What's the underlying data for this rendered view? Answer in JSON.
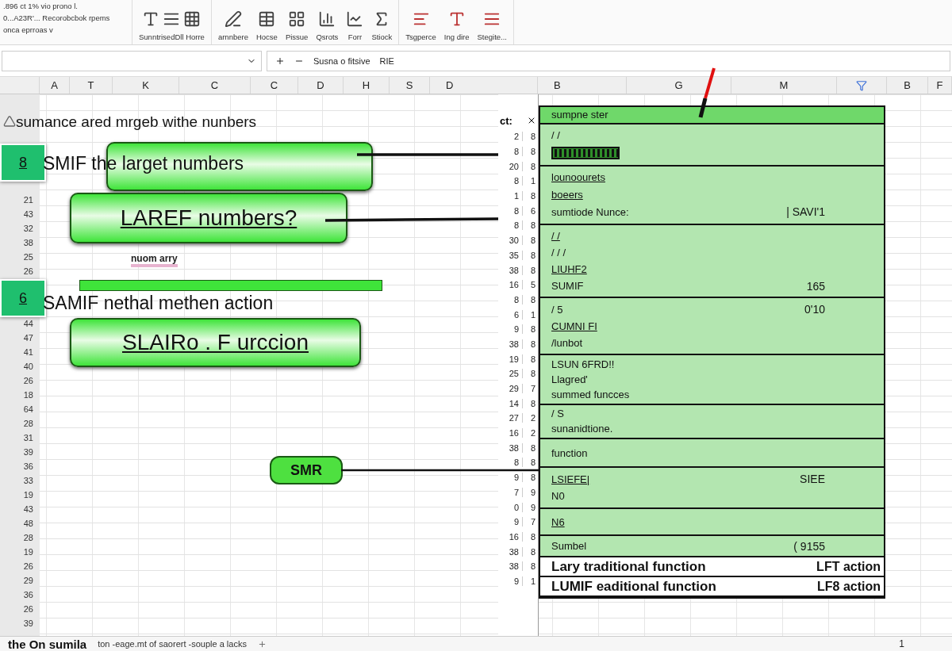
{
  "ribbon": {
    "info_lines": [
      ".896 ct 1% vio prono l.",
      "0...A23R'... Recorobcbok rpems",
      "onca eprroas v"
    ],
    "groups": [
      {
        "buttons": [
          "SunntrisedDll Horre"
        ]
      },
      {
        "buttons": [
          "arnnbere",
          "Hocse",
          "Pissue",
          "Qsrots",
          "Forr",
          "Stiock"
        ]
      },
      {
        "buttons": [
          "Tsgperce",
          "Ing dire",
          "Stegite..."
        ]
      }
    ]
  },
  "formula_bar": {
    "formula": "Susna o fitsive",
    "value": "RIE"
  },
  "columns": [
    {
      "label": "A",
      "kind": "letter"
    },
    {
      "label": "T",
      "kind": "letter"
    },
    {
      "label": "K",
      "kind": "letter"
    },
    {
      "label": "C",
      "kind": "letter"
    },
    {
      "label": "C",
      "kind": "letter"
    },
    {
      "label": "D",
      "kind": "letter"
    },
    {
      "label": "H",
      "kind": "letter"
    },
    {
      "label": "S",
      "kind": "letter"
    },
    {
      "label": "D",
      "kind": "letter"
    },
    {
      "label": "B",
      "kind": "letter"
    },
    {
      "label": "G",
      "kind": "letter"
    },
    {
      "label": "M",
      "kind": "letter"
    },
    {
      "kind": "filter"
    },
    {
      "label": "B",
      "kind": "letter"
    },
    {
      "label": "F",
      "kind": "letter"
    }
  ],
  "row_numbers": [
    "21",
    "43",
    "32",
    "38",
    "25",
    "26",
    "44",
    "47",
    "41",
    "40",
    "26",
    "18",
    "64",
    "28",
    "31",
    "39",
    "36",
    "33",
    "19",
    "43",
    "48",
    "28",
    "19",
    "26",
    "29",
    "36",
    "26",
    "39"
  ],
  "canvas": {
    "heading": "sumance ared mrgeb withe nunbers",
    "tags": [
      "8",
      "6"
    ],
    "callouts": [
      "SMIF the larget numbers",
      "LAREF numbers?",
      "SAMIF nethal methen action",
      "SLAIRo . F urccion"
    ],
    "note": "nuom arry",
    "pill": "SMR"
  },
  "number_column": {
    "header": "ct:",
    "rows": [
      {
        "a": "2",
        "b": "8"
      },
      {
        "a": "8",
        "b": "8"
      },
      {
        "a": "20",
        "b": "8"
      },
      {
        "a": "8",
        "b": "1"
      },
      {
        "a": "1",
        "b": "8"
      },
      {
        "a": "8",
        "b": "6"
      },
      {
        "a": "8",
        "b": "8"
      },
      {
        "a": "30",
        "b": "8"
      },
      {
        "a": "35",
        "b": "8"
      },
      {
        "a": "38",
        "b": "8"
      },
      {
        "a": "16",
        "b": "5"
      },
      {
        "a": "8",
        "b": "8"
      },
      {
        "a": "6",
        "b": "1"
      },
      {
        "a": "9",
        "b": "8"
      },
      {
        "a": "38",
        "b": "8"
      },
      {
        "a": "19",
        "b": "8"
      },
      {
        "a": "25",
        "b": "8"
      },
      {
        "a": "29",
        "b": "7"
      },
      {
        "a": "14",
        "b": "8"
      },
      {
        "a": "27",
        "b": "2"
      },
      {
        "a": "16",
        "b": "2"
      },
      {
        "a": "38",
        "b": "8"
      },
      {
        "a": "8",
        "b": "8"
      },
      {
        "a": "9",
        "b": "8"
      },
      {
        "a": "7",
        "b": "9"
      },
      {
        "a": "0",
        "b": "9"
      },
      {
        "a": "9",
        "b": "7"
      },
      {
        "a": "16",
        "b": "8"
      },
      {
        "a": "38",
        "b": "8"
      },
      {
        "a": "38",
        "b": "8"
      },
      {
        "a": "9",
        "b": "1"
      }
    ]
  },
  "panel": {
    "sections": [
      {
        "kind": "header",
        "lines": [
          {
            "kind": "text",
            "text": "sumpne ster",
            "underline": false
          }
        ]
      },
      {
        "kind": "plain",
        "lines": [
          {
            "kind": "text",
            "text": "/ /",
            "underline": false
          },
          {
            "kind": "bar"
          }
        ]
      },
      {
        "kind": "plain",
        "lines": [
          {
            "kind": "text",
            "text": "lounoourets",
            "underline": true
          },
          {
            "kind": "text",
            "text": "boeers",
            "underline": true
          },
          {
            "kind": "text",
            "text": "sumtiode Nunce:",
            "value": "| SAVI'1",
            "underline": false
          }
        ]
      },
      {
        "kind": "plain",
        "lines": [
          {
            "kind": "text",
            "text": "/ /",
            "underline": true
          },
          {
            "kind": "text",
            "text": "/ / /",
            "underline": false
          },
          {
            "kind": "text",
            "text": "LIUHF2",
            "underline": true
          },
          {
            "kind": "text",
            "text": "SUMIF",
            "value": "165",
            "underline": false
          }
        ]
      },
      {
        "kind": "plain",
        "lines": [
          {
            "kind": "text",
            "text": "/ 5",
            "value": "0'10",
            "underline": false
          },
          {
            "kind": "text",
            "text": "CUMNI FI",
            "underline": true
          },
          {
            "kind": "text",
            "text": "/lunbot",
            "underline": false
          }
        ]
      },
      {
        "kind": "plain",
        "lines": [
          {
            "kind": "text",
            "text": "LSUN 6FRD!!",
            "underline": false
          },
          {
            "kind": "text",
            "text": "Llagred'",
            "underline": false
          },
          {
            "kind": "text",
            "text": "summed funcces",
            "underline": false
          }
        ]
      },
      {
        "kind": "plain",
        "lines": [
          {
            "kind": "text",
            "text": "/ S",
            "underline": false
          },
          {
            "kind": "text",
            "text": "sunanidtione.",
            "underline": false
          }
        ]
      },
      {
        "kind": "plain",
        "lines": [
          {
            "kind": "text",
            "text": "function",
            "underline": false
          }
        ]
      },
      {
        "kind": "plain",
        "lines": [
          {
            "kind": "text",
            "text": "LSIEFE|",
            "value": "SIEE",
            "underline": true
          },
          {
            "kind": "text",
            "text": "N0",
            "underline": false
          }
        ]
      },
      {
        "kind": "plain",
        "lines": [
          {
            "kind": "text",
            "text": "N6",
            "underline": true
          }
        ]
      },
      {
        "kind": "plain",
        "lines": [
          {
            "kind": "text",
            "text": "Sumbel",
            "value": "( 9155",
            "underline": false
          }
        ]
      },
      {
        "kind": "white",
        "lines": [
          {
            "kind": "text",
            "text": "Lary traditional function",
            "value": "LFT action",
            "underline": false
          }
        ]
      },
      {
        "kind": "white",
        "lines": [
          {
            "kind": "text",
            "text": "LUMIF eaditional function",
            "value": "LF8 action",
            "underline": false
          }
        ]
      }
    ]
  },
  "status_bar": {
    "title": "the On sumila",
    "message": "ton -eage.mt of saorert -souple a lacks",
    "page": "1"
  }
}
